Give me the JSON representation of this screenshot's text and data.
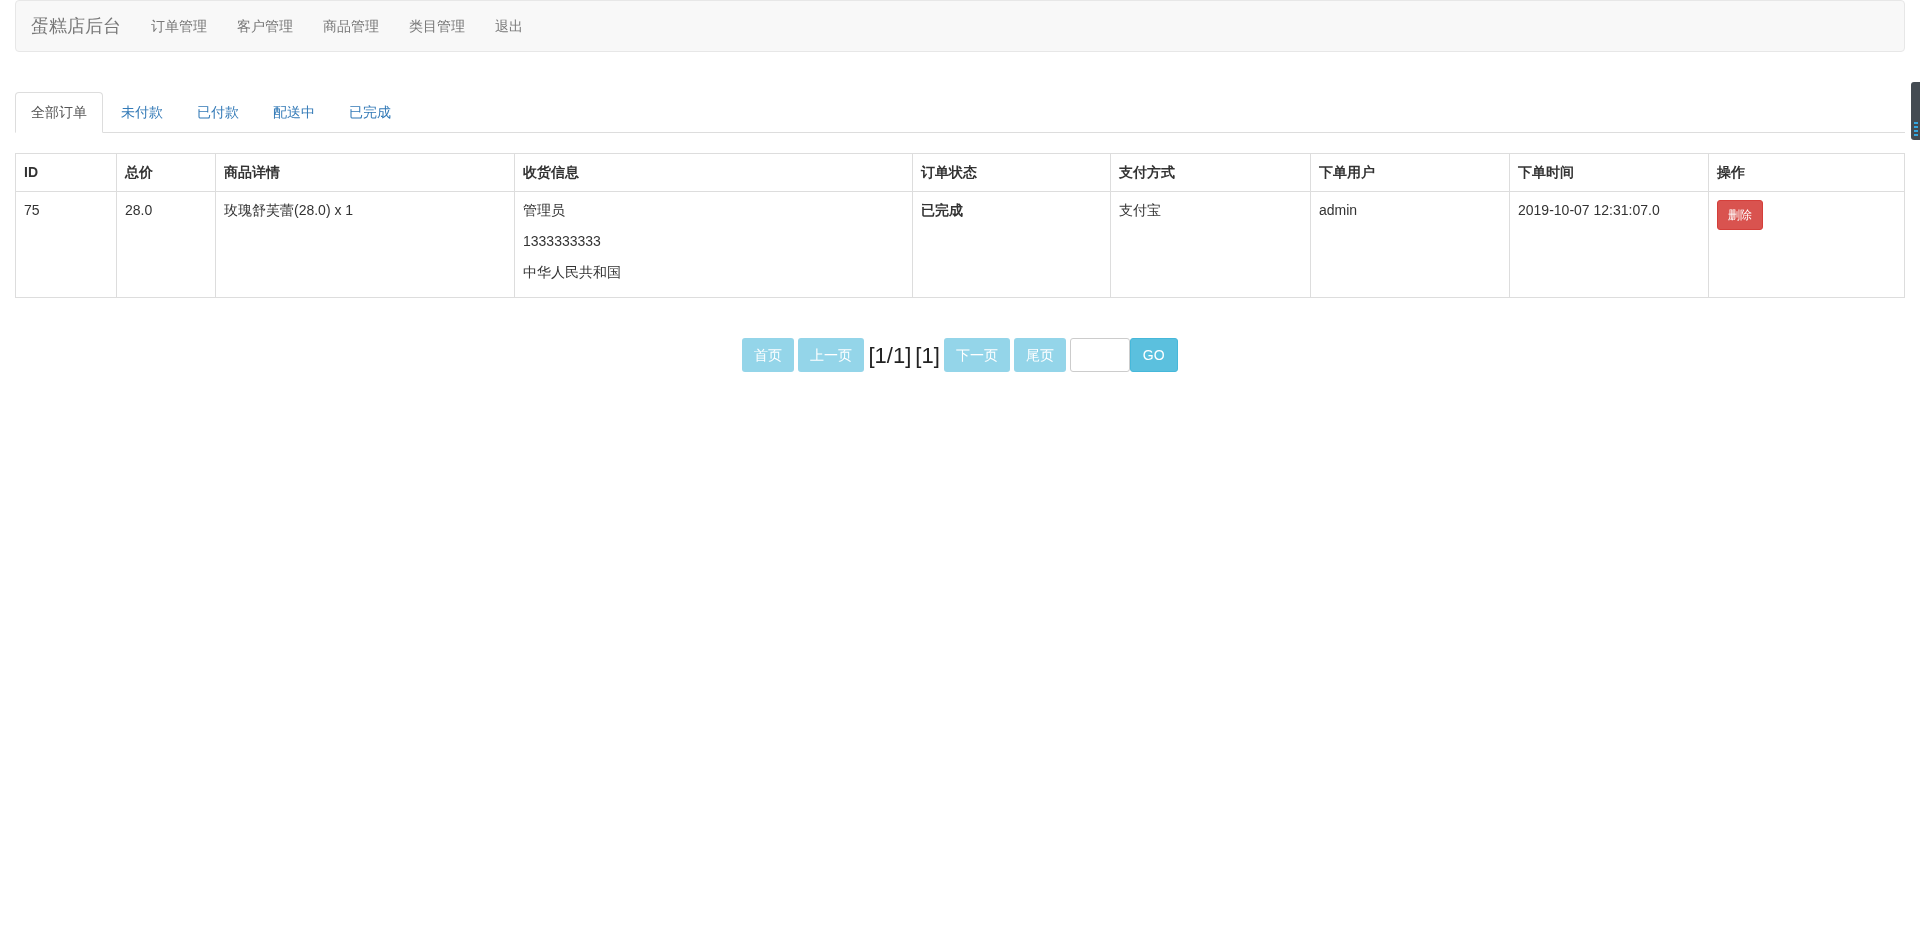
{
  "navbar": {
    "brand": "蛋糕店后台",
    "items": [
      "订单管理",
      "客户管理",
      "商品管理",
      "类目管理",
      "退出"
    ]
  },
  "tabs": [
    {
      "label": "全部订单",
      "selected": true
    },
    {
      "label": "未付款",
      "selected": false
    },
    {
      "label": "已付款",
      "selected": false
    },
    {
      "label": "配送中",
      "selected": false
    },
    {
      "label": "已完成",
      "selected": false
    }
  ],
  "table": {
    "columns": [
      "ID",
      "总价",
      "商品详情",
      "收货信息",
      "订单状态",
      "支付方式",
      "下单用户",
      "下单时间",
      "操作"
    ],
    "rows": [
      {
        "cells": [
          {
            "kind": "text",
            "text": "75"
          },
          {
            "kind": "text",
            "text": "28.0"
          },
          {
            "kind": "text",
            "text": "玫瑰舒芙蕾(28.0) x 1"
          },
          {
            "kind": "lines",
            "lines": [
              "管理员",
              "1333333333",
              "中华人民共和国"
            ]
          },
          {
            "kind": "bold",
            "text": "已完成"
          },
          {
            "kind": "text",
            "text": "支付宝"
          },
          {
            "kind": "text",
            "text": "admin"
          },
          {
            "kind": "text",
            "text": "2019-10-07 12:31:07.0"
          },
          {
            "kind": "button",
            "text": "删除"
          }
        ]
      }
    ]
  },
  "pager": [
    {
      "kind": "button",
      "label": "首页",
      "disabled": true
    },
    {
      "kind": "button",
      "label": "上一页",
      "disabled": true
    },
    {
      "kind": "text",
      "label": "[1/1]"
    },
    {
      "kind": "text",
      "label": "[1]"
    },
    {
      "kind": "button",
      "label": "下一页",
      "disabled": true
    },
    {
      "kind": "button",
      "label": "尾页",
      "disabled": true
    },
    {
      "kind": "input"
    },
    {
      "kind": "button",
      "label": "GO",
      "disabled": false
    }
  ]
}
